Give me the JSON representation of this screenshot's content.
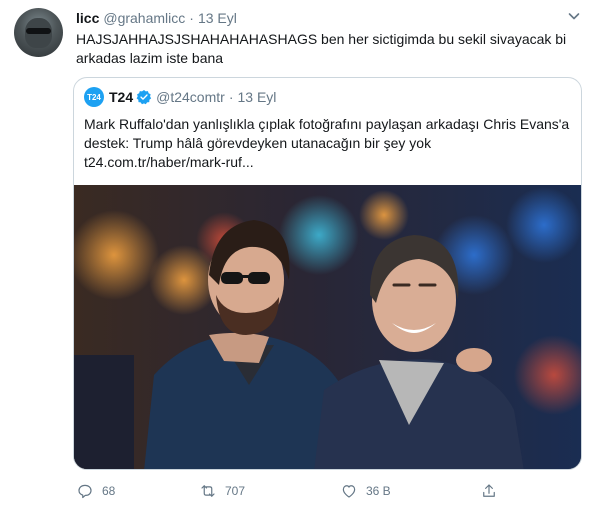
{
  "tweet": {
    "author": {
      "name": "licc",
      "handle": "@grahamlicc"
    },
    "separator": "·",
    "date": "13 Eyl",
    "text": "HAJSJAHHAJSJSHAHAHAHASHAGS ben her sictigimda bu sekil sivayacak bi arkadas lazim iste bana",
    "menu_icon": "chevron-down-icon"
  },
  "quoted": {
    "logo_text": "T24",
    "author": {
      "name": "T24",
      "handle": "@t24comtr",
      "verified": true
    },
    "separator": "·",
    "date": "13 Eyl",
    "text": "Mark Ruffalo'dan yanlışlıkla çıplak fotoğrafını paylaşan arkadaşı Chris Evans'a destek: Trump hâlâ görevdeyken utanacağın bir şey yok t24.com.tr/haber/mark-ruf...",
    "media_icon": "photo"
  },
  "actions": {
    "reply": {
      "icon": "reply-icon",
      "count": "68"
    },
    "retweet": {
      "icon": "retweet-icon",
      "count": "707"
    },
    "like": {
      "icon": "heart-icon",
      "count": "36 B"
    },
    "share": {
      "icon": "share-icon"
    }
  },
  "colors": {
    "text": "#14171a",
    "secondary": "#657786",
    "border": "#ccd6dd",
    "accent": "#1da1f2"
  }
}
